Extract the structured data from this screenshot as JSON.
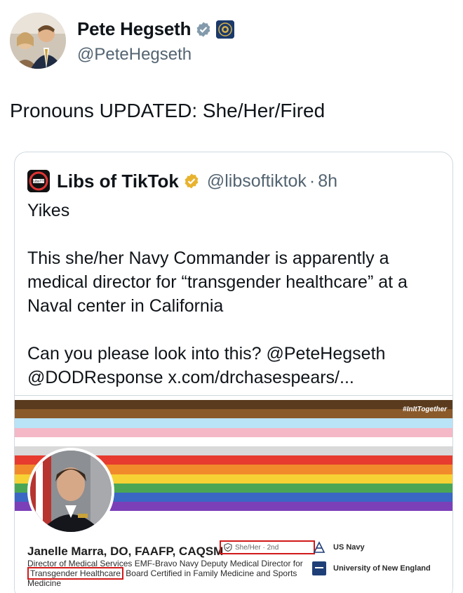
{
  "author": {
    "display_name": "Pete Hegseth",
    "handle": "@PeteHegseth",
    "avatar_icon": "profile-photo",
    "verified_icon": "verified-badge-icon",
    "affiliation_icon": "department-of-defense-seal-icon"
  },
  "post": {
    "text": "Pronouns UPDATED: She/Her/Fired"
  },
  "quoted_post": {
    "display_name": "Libs of TikTok",
    "handle": "@libsoftiktok",
    "separator": "·",
    "time": "8h",
    "verified_color": "#e8b22e",
    "paragraphs": [
      "Yikes",
      "This she/her Navy Commander is apparently a medical director for “transgender healthcare” at a Naval center in California",
      "Can you please look into this? @PeteHegseth @DODResponse x.com/drchasespears/..."
    ],
    "image": {
      "hashtag": "#InItTogether",
      "flag_colors": [
        "#5a3b1e",
        "#8a5a2b",
        "#b9e3f6",
        "#f5b8c6",
        "#ffffff",
        "#d9d9d9",
        "#e63b2e",
        "#f18a2b",
        "#f7d234",
        "#4aa654",
        "#3b67c4",
        "#7b3fb8"
      ],
      "profile_name": "Janelle Marra, DO, FAAFP, CAQSM",
      "pronoun_badge": "She/Her · 2nd",
      "headline_part1": "Director of Medical Services EMF-Bravo Navy Deputy Medical Director for ",
      "headline_highlight": "Transgender Healthcare",
      "headline_part2": " Board Certified in Family Medicine and Sports Medicine",
      "affiliations": [
        "US Navy",
        "University of New England"
      ],
      "highlight_color": "#d11a1a"
    }
  }
}
